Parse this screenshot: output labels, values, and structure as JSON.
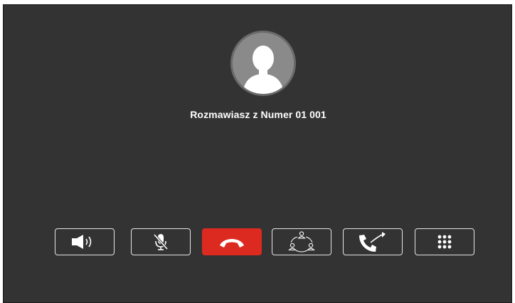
{
  "call": {
    "status_text": "Rozmawiasz z Numer 01 001"
  },
  "caller": {
    "avatar_icon": "person-silhouette-icon"
  },
  "controls": [
    {
      "name": "speaker-button",
      "icon": "speaker-icon"
    },
    {
      "name": "mute-microphone-button",
      "icon": "microphone-muted-icon"
    },
    {
      "name": "hang-up-button",
      "icon": "phone-hangup-icon",
      "color": "#dd2a21"
    },
    {
      "name": "conference-button",
      "icon": "conference-group-icon"
    },
    {
      "name": "transfer-call-button",
      "icon": "call-transfer-icon"
    },
    {
      "name": "dialpad-button",
      "icon": "dialpad-icon"
    }
  ],
  "colors": {
    "background": "#333333",
    "accent_hangup": "#dd2a21",
    "button_border": "#e6e6e6",
    "text": "#ffffff"
  }
}
